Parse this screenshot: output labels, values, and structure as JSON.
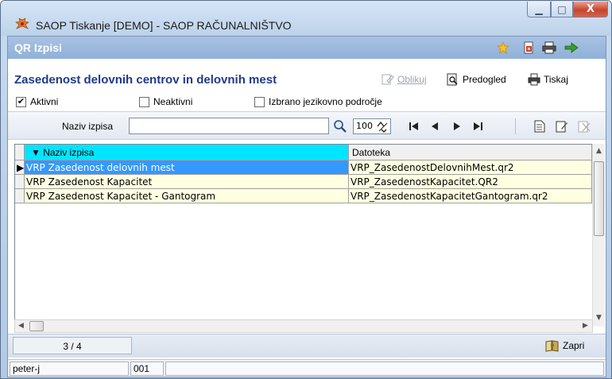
{
  "window": {
    "title": "SAOP Tiskanje [DEMO] - SAOP RAČUNALNIŠTVO",
    "minimize_label": "▁",
    "maximize_label": "□",
    "close_label": "X"
  },
  "panel": {
    "title": "QR Izpisi"
  },
  "report": {
    "heading": "Zasedenost delovnih centrov in delovnih mest",
    "oblikuj_label": "Oblikuj",
    "predogled_label": "Predogled",
    "tiskaj_label": "Tiskaj"
  },
  "filters": {
    "aktivni_label": "Aktivni",
    "aktivni_checked": true,
    "neaktivni_label": "Neaktivni",
    "neaktivni_checked": false,
    "jezik_label": "Izbrano jezikovno področje",
    "jezik_checked": false
  },
  "search": {
    "label": "Naziv izpisa",
    "value": "",
    "page_size": "100"
  },
  "table": {
    "columns": [
      "Naziv izpisa",
      "Datoteka",
      " "
    ],
    "rows": [
      {
        "naziv": "VRP Zasedenost delovnih mest",
        "datoteka": "VRP_ZasedenostDelovnihMest.qr2"
      },
      {
        "naziv": "VRP Zasedenost Kapacitet",
        "datoteka": "VRP_ZasedenostKapacitet.QR2"
      },
      {
        "naziv": "VRP Zasedenost Kapacitet - Gantogram",
        "datoteka": "VRP_ZasedenostKapacitetGantogram.qr2"
      }
    ],
    "selected_row": 0
  },
  "status": {
    "record": "3 / 4",
    "zapri_label": "Zapri",
    "user": "peter-j",
    "code": "001"
  },
  "colors": {
    "heading": "#1f3a8c",
    "header_highlight": "#00e5ff",
    "selected_row": "#3399ff",
    "row_bg": "#ffffe1"
  }
}
